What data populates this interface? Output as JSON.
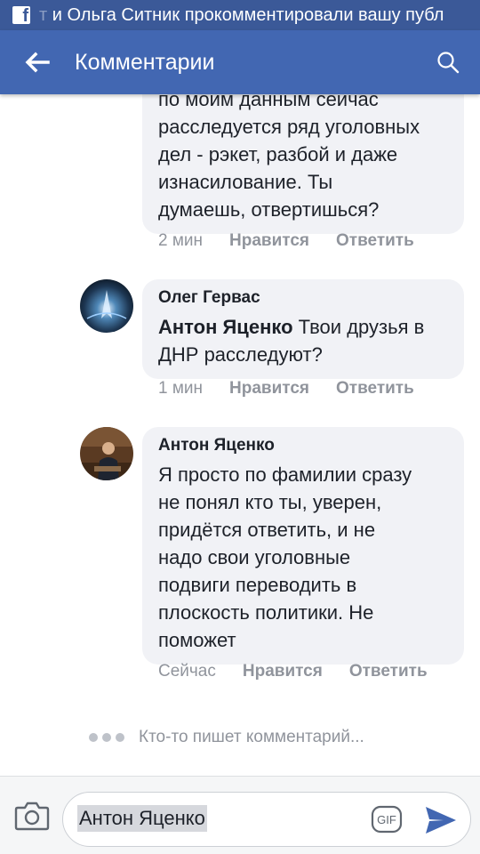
{
  "status_bar": {
    "notification_prefix": "т ",
    "notification": "и Ольга Ситник прокомментировали вашу публ"
  },
  "app_bar": {
    "title": "Комментарии"
  },
  "comments": [
    {
      "author": "",
      "lines": [
        "по моим данным сейчас",
        "расследуется ряд уголовных",
        "дел - рэкет, разбой и даже",
        "изнасилование. Ты",
        "думаешь, отвертишься?"
      ],
      "time": "2 мин",
      "like": "Нравится",
      "reply": "Ответить"
    },
    {
      "author": "Олег Гервас",
      "mention": "Антон Яценко",
      "text_line1": " Твои друзья в",
      "text_line2": "ДНР расследуют?",
      "time": "1 мин",
      "like": "Нравится",
      "reply": "Ответить"
    },
    {
      "author": "Антон Яценко",
      "lines": [
        "Я просто по фамилии сразу",
        "не понял кто ты, уверен,",
        "придётся ответить, и не",
        "надо свои уголовные",
        "подвиги переводить в",
        "плоскость политики. Не",
        "поможет"
      ],
      "time": "Сейчас",
      "like": "Нравится",
      "reply": "Ответить"
    }
  ],
  "typing_indicator": "Кто-то пишет комментарий...",
  "composer": {
    "value": "Антон Яценко",
    "gif_label": "GIF"
  },
  "colors": {
    "status_bar": "#3b5998",
    "app_bar": "#4267b2",
    "bubble": "#f1f2f6",
    "meta_text": "#90949c",
    "send": "#4267b2"
  },
  "icons": [
    "facebook-icon",
    "back-arrow-icon",
    "search-icon",
    "avatar-oleg",
    "avatar-anton",
    "camera-icon",
    "gif-icon",
    "send-icon"
  ]
}
